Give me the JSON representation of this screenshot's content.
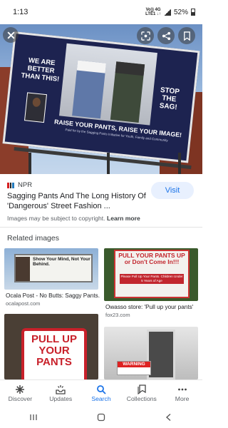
{
  "status_bar": {
    "time": "1:13",
    "network_top": "Vo)) 4G",
    "network_bottom": "LTE1 ↓↑",
    "battery": "52%"
  },
  "hero": {
    "billboard_left": "WE ARE BETTER THAN THIS!",
    "billboard_right": "STOP THE SAG!",
    "billboard_bottom": "RAISE YOUR PANTS, RAISE YOUR IMAGE!",
    "billboard_small": "Paid for by the Sagging Pants Initiative for Youth, Family and Community"
  },
  "result": {
    "source": "NPR",
    "source_logo_colors": [
      "#d62021",
      "#222222",
      "#237bbd"
    ],
    "title": "Sagging Pants And The Long History Of 'Dangerous' Street Fashion ...",
    "visit_label": "Visit",
    "copyright_text": "Images may be subject to copyright.",
    "learn_more": "Learn more"
  },
  "related": {
    "heading": "Related images",
    "items": [
      {
        "caption": "Ocala Post - No Butts: Saggy Pants...",
        "source": "ocalapost.com",
        "image_text": "Show Your Mind, Not Your Behind."
      },
      {
        "caption": "Owasso store: 'Pull up your pants'",
        "source": "fox23.com",
        "image_title": "PULL YOUR PANTS UP or Don't Come In!!!",
        "image_text": "Please Pull Up Your Pants. Children Under 5 Years of Age"
      },
      {
        "image_title": "PULL UP YOUR PANTS"
      },
      {
        "image_text": "WARNING"
      }
    ]
  },
  "bottom_nav": {
    "items": [
      {
        "label": "Discover",
        "icon": "asterisk-icon"
      },
      {
        "label": "Updates",
        "icon": "updates-icon"
      },
      {
        "label": "Search",
        "icon": "search-icon",
        "active": true
      },
      {
        "label": "Collections",
        "icon": "bookmark-icon"
      },
      {
        "label": "More",
        "icon": "more-icon"
      }
    ]
  },
  "colors": {
    "accent": "#1a73e8",
    "billboard_navy": "#1d2350",
    "sign_red": "#c8202a"
  }
}
